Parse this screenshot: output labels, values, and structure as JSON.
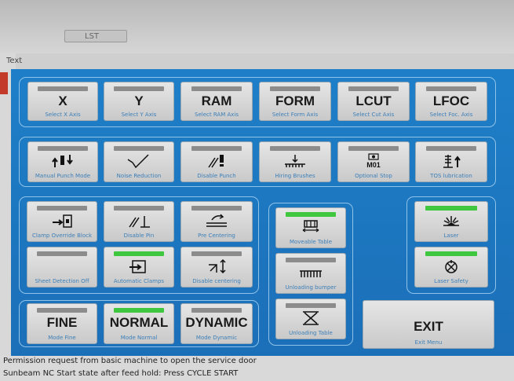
{
  "window": {
    "tab_label": "LST",
    "text_label": "Text"
  },
  "axes": [
    {
      "label": "X",
      "caption": "Select X Axis"
    },
    {
      "label": "Y",
      "caption": "Select Y Axis"
    },
    {
      "label": "RAM",
      "caption": "Select RAM Axis"
    },
    {
      "label": "FORM",
      "caption": "Select Form Axis"
    },
    {
      "label": "LCUT",
      "caption": "Select Cut Axis"
    },
    {
      "label": "LFOC",
      "caption": "Select Foc. Axis"
    }
  ],
  "functions": [
    {
      "caption": "Manual Punch Mode",
      "icon": "punch-mode-icon",
      "active": false
    },
    {
      "caption": "Noise Reduction",
      "icon": "noise-reduction-icon",
      "active": false
    },
    {
      "caption": "Disable Punch",
      "icon": "disable-punch-icon",
      "active": false
    },
    {
      "caption": "Hiring Brushes",
      "icon": "brushes-icon",
      "active": false
    },
    {
      "caption": "Optional Stop",
      "icon": "optional-stop-icon",
      "active": false,
      "icon_text": "M01"
    },
    {
      "caption": "TOS lubrication",
      "icon": "lubrication-icon",
      "active": false
    }
  ],
  "clamps": [
    {
      "caption": "Clamp Override Block",
      "icon": "clamp-block-icon",
      "active": false
    },
    {
      "caption": "Disable Pin",
      "icon": "disable-pin-icon",
      "active": false
    },
    {
      "caption": "Pre Centering",
      "icon": "pre-centering-icon",
      "active": false
    },
    {
      "caption": "Sheet Detection Off",
      "icon": "sheet-detection-icon",
      "active": false
    },
    {
      "caption": "Automatic Clamps",
      "icon": "automatic-clamps-icon",
      "active": true
    },
    {
      "caption": "Disable centering",
      "icon": "disable-centering-icon",
      "active": false
    }
  ],
  "tables": [
    {
      "caption": "Moveable Table",
      "icon": "moveable-table-icon",
      "active": true
    },
    {
      "caption": "Unloading bumper",
      "icon": "unloading-bumper-icon",
      "active": false
    },
    {
      "caption": "Unloading Table",
      "icon": "unloading-table-icon",
      "active": false
    }
  ],
  "laser": [
    {
      "caption": "Laser",
      "icon": "laser-icon",
      "active": true
    },
    {
      "caption": "Laser Safety",
      "icon": "laser-safety-icon",
      "active": true
    }
  ],
  "modes": [
    {
      "label": "FINE",
      "caption": "Mode Fine",
      "active": false
    },
    {
      "label": "NORMAL",
      "caption": "Mode Normal",
      "active": true
    },
    {
      "label": "DYNAMIC",
      "caption": "Mode Dynamic",
      "active": false
    }
  ],
  "exit": {
    "label": "EXIT",
    "caption": "Exit Menu"
  },
  "status": {
    "line1": "Permission request from basic machine to open the service door",
    "line2": "Sunbeam NC Start state after feed hold: Press CYCLE START"
  },
  "colors": {
    "panel": "#1e7fc8",
    "indicator_on": "#3fc83f",
    "indicator_off": "#8c8c8c"
  }
}
